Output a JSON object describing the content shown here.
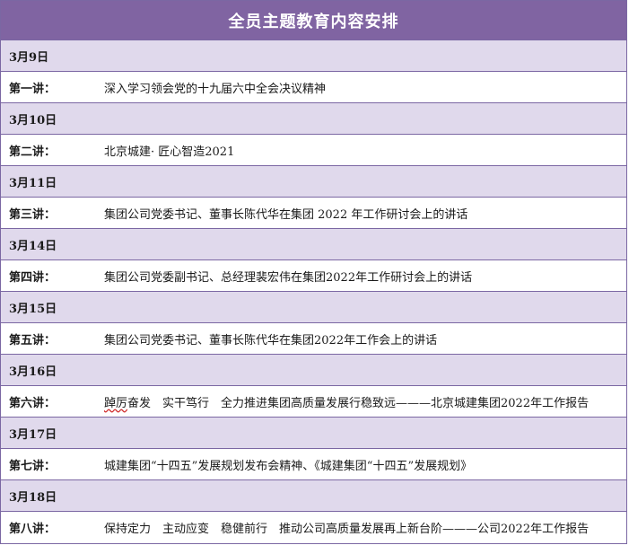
{
  "title": "全员主题教育内容安排",
  "schedule": [
    {
      "date": "3月9日",
      "lecture": "第一讲：",
      "topic": "深入学习领会党的十九届六中全会决议精神"
    },
    {
      "date": "3月10日",
      "lecture": "第二讲：",
      "topic": "北京城建· 匠心智造2021"
    },
    {
      "date": "3月11日",
      "lecture": "第三讲：",
      "topic": "集团公司党委书记、董事长陈代华在集团 2022 年工作研讨会上的讲话"
    },
    {
      "date": "3月14日",
      "lecture": "第四讲：",
      "topic": "集团公司党委副书记、总经理裴宏伟在集团2022年工作研讨会上的讲话"
    },
    {
      "date": "3月15日",
      "lecture": "第五讲：",
      "topic": "集团公司党委书记、董事长陈代华在集团2022年工作会上的讲话"
    },
    {
      "date": "3月16日",
      "lecture": "第六讲：",
      "topic_prefix": "踔厉",
      "topic": "奋发　实干笃行　全力推进集团高质量发展行稳致远———北京城建集团2022年工作报告"
    },
    {
      "date": "3月17日",
      "lecture": "第七讲：",
      "topic": "城建集团“十四五”发展规划发布会精神、《城建集团“十四五”发展规划》"
    },
    {
      "date": "3月18日",
      "lecture": "第八讲：",
      "topic": "保持定力　主动应变　稳健前行　推动公司高质量发展再上新台阶———公司2022年工作报告"
    }
  ]
}
